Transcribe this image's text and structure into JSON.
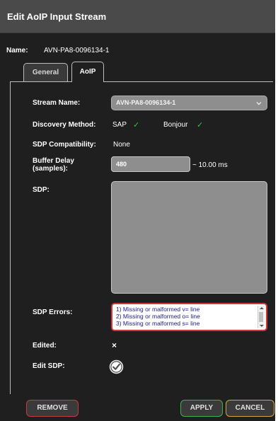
{
  "dialog": {
    "title": "Edit AoIP Input Stream",
    "name_label": "Name:",
    "name_value": "AVN-PA8-0096134-1"
  },
  "tabs": [
    {
      "label": "General",
      "active": false
    },
    {
      "label": "AoIP",
      "active": true
    }
  ],
  "form": {
    "stream_name_label": "Stream Name:",
    "stream_name_value": "AVN-PA8-0096134-1",
    "discovery_label": "Discovery Method:",
    "discovery_options": [
      {
        "label": "SAP",
        "checked": true
      },
      {
        "label": "Bonjour",
        "checked": true
      }
    ],
    "sdp_compat_label": "SDP Compatibility:",
    "sdp_compat_value": "None",
    "buffer_label_line1": "Buffer Delay",
    "buffer_label_line2": "(samples):",
    "buffer_value": "480",
    "buffer_ms": "~ 10.00 ms",
    "sdp_label": "SDP:",
    "sdp_value": "",
    "sdp_errors_label": "SDP Errors:",
    "sdp_errors": [
      "1) Missing or malformed v= line",
      "2) Missing or malformed o= line",
      "3) Missing or malformed s= line"
    ],
    "edited_label": "Edited:",
    "edited_value": "×",
    "edit_sdp_label": "Edit SDP:",
    "edit_sdp_checked": true
  },
  "buttons": {
    "remove": "REMOVE",
    "apply": "APPLY",
    "cancel": "CANCEL"
  },
  "colors": {
    "check_green": "#3fbf3f",
    "error_red": "#d2373c",
    "apply_green": "#3db24a",
    "cancel_orange": "#d9a33a"
  }
}
